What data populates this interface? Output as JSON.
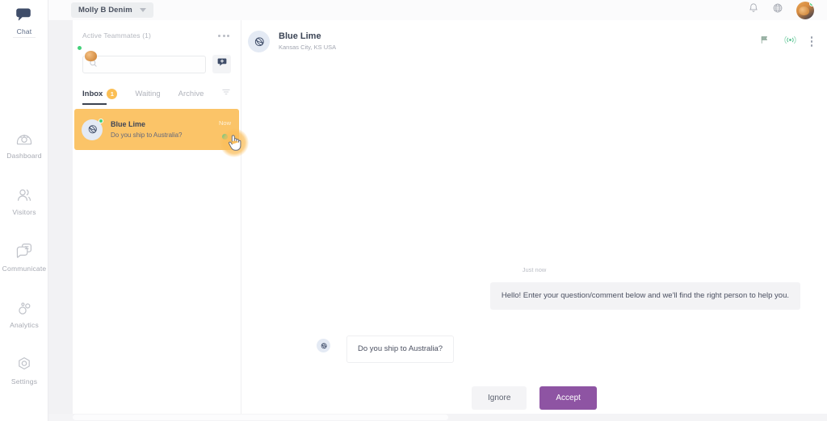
{
  "nav": {
    "items": [
      {
        "label": "Chat",
        "icon": "chat-bubble-icon",
        "active": true
      },
      {
        "label": "Dashboard",
        "icon": "dashboard-gauge-icon",
        "active": false
      },
      {
        "label": "Visitors",
        "icon": "visitors-people-icon",
        "active": false
      },
      {
        "label": "Communicate",
        "icon": "communicate-message-icon",
        "active": false
      },
      {
        "label": "Analytics",
        "icon": "analytics-bubbles-icon",
        "active": false
      },
      {
        "label": "Settings",
        "icon": "settings-gear-icon",
        "active": false
      }
    ]
  },
  "topbar": {
    "org_name": "Molly B Denim",
    "caret_icon": "chevron-down-icon",
    "bell_icon": "notifications-bell-icon",
    "globe_icon": "globe-icon",
    "avatar_icon": "user-avatar",
    "status_color": "#44d17a"
  },
  "conversations_panel": {
    "teammates_title": "Active Teammates (1)",
    "more_icon": "more-horizontal-icon",
    "teammate_avatar_icon": "teammate-avatar",
    "search": {
      "value": "",
      "placeholder": "",
      "icon": "search-icon"
    },
    "new_chat_icon": "new-chat-bubble-icon",
    "filter_icon": "filter-icon",
    "tabs": [
      {
        "label": "Inbox",
        "badge": "1",
        "active": true
      },
      {
        "label": "Waiting",
        "badge": "",
        "active": false
      },
      {
        "label": "Archive",
        "badge": "",
        "active": false
      }
    ],
    "items": [
      {
        "name": "Blue Lime",
        "snippet": "Do you ship to Australia?",
        "time": "Now",
        "avatar_icon": "visitor-globe-avatar",
        "selected": true,
        "online": true
      }
    ],
    "selected_color": "#fbc468"
  },
  "chat": {
    "header": {
      "title": "Blue Lime",
      "subtitle": "Kansas City, KS USA",
      "avatar_icon": "visitor-globe-avatar",
      "flag_icon": "flag-icon",
      "live_icon": "live-broadcast-icon",
      "menu_icon": "more-vertical-icon"
    },
    "timestamp": "Just now",
    "messages": [
      {
        "from": "agent",
        "text": "Hello! Enter your question/comment below and we'll find the right person to help you."
      },
      {
        "from": "visitor",
        "text": "Do you ship to Australia?",
        "avatar_icon": "visitor-globe-avatar"
      }
    ],
    "actions": {
      "ignore_label": "Ignore",
      "accept_label": "Accept",
      "accept_color": "#8e54a3"
    }
  },
  "cursor": {
    "icon": "pointing-hand-cursor",
    "highlight_color": "#fbbe5a"
  }
}
